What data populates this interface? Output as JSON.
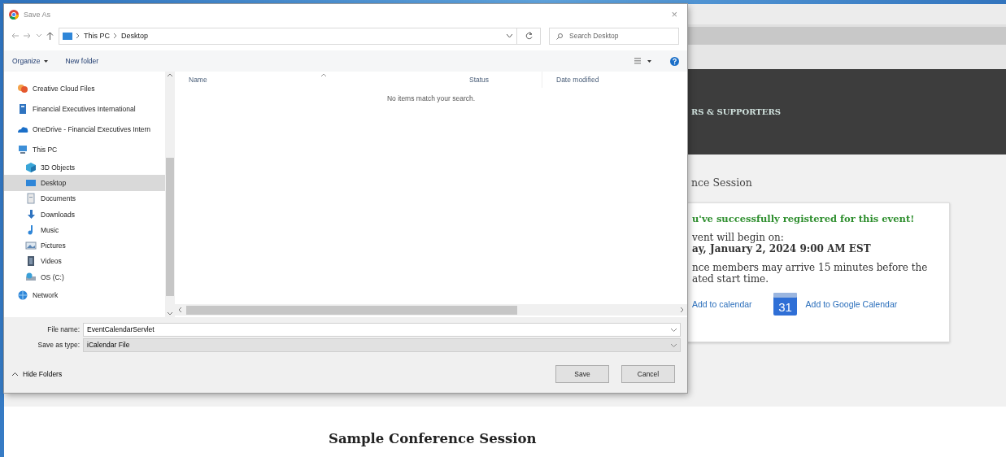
{
  "page": {
    "header_text": "RS & SUPPORTERS",
    "session_crumb": "nce Session",
    "card": {
      "success": "u've successfully registered for this event!",
      "begin_label": "vent will begin on:",
      "begin_date": "ay, January 2, 2024 9:00 AM EST",
      "note_lines": [
        "nce members may arrive 15 minutes before the",
        "ated start time."
      ],
      "links": [
        {
          "kind": "plain",
          "label": "Add to calendar"
        },
        {
          "kind": "google",
          "label": "Add to Google Calendar",
          "badge": "31"
        }
      ]
    },
    "footer_title": "Sample Conference Session"
  },
  "dialog": {
    "title": "Save As",
    "close_glyph": "×",
    "path": [
      "This PC",
      "Desktop"
    ],
    "search": {
      "placeholder": "Search Desktop"
    },
    "toolbar": {
      "organize": "Organize",
      "new_folder": "New folder"
    },
    "nav_items": [
      {
        "kind": "creative-cloud",
        "label": "Creative Cloud Files",
        "selected": false
      },
      {
        "kind": "building",
        "label": "Financial Executives International",
        "selected": false
      },
      {
        "kind": "onedrive",
        "label": "OneDrive - Financial Executives Intern",
        "selected": false
      },
      {
        "kind": "computer",
        "label": "This PC",
        "selected": false,
        "children": [
          {
            "kind": "cube",
            "label": "3D Objects",
            "selected": false
          },
          {
            "kind": "desktop",
            "label": "Desktop",
            "selected": true
          },
          {
            "kind": "documents",
            "label": "Documents",
            "selected": false
          },
          {
            "kind": "downloads",
            "label": "Downloads",
            "selected": false
          },
          {
            "kind": "music",
            "label": "Music",
            "selected": false
          },
          {
            "kind": "pictures",
            "label": "Pictures",
            "selected": false
          },
          {
            "kind": "videos",
            "label": "Videos",
            "selected": false
          },
          {
            "kind": "drive",
            "label": "OS (C:)",
            "selected": false
          }
        ]
      },
      {
        "kind": "network",
        "label": "Network",
        "selected": false
      }
    ],
    "columns": [
      "Name",
      "Status",
      "Date modified"
    ],
    "empty_message": "No items match your search.",
    "file_name": {
      "label": "File name:",
      "value": "EventCalendarServlet"
    },
    "save_type": {
      "label": "Save as type:",
      "value": "iCalendar File"
    },
    "hide_folders": "Hide Folders",
    "buttons": [
      "Save",
      "Cancel"
    ]
  }
}
